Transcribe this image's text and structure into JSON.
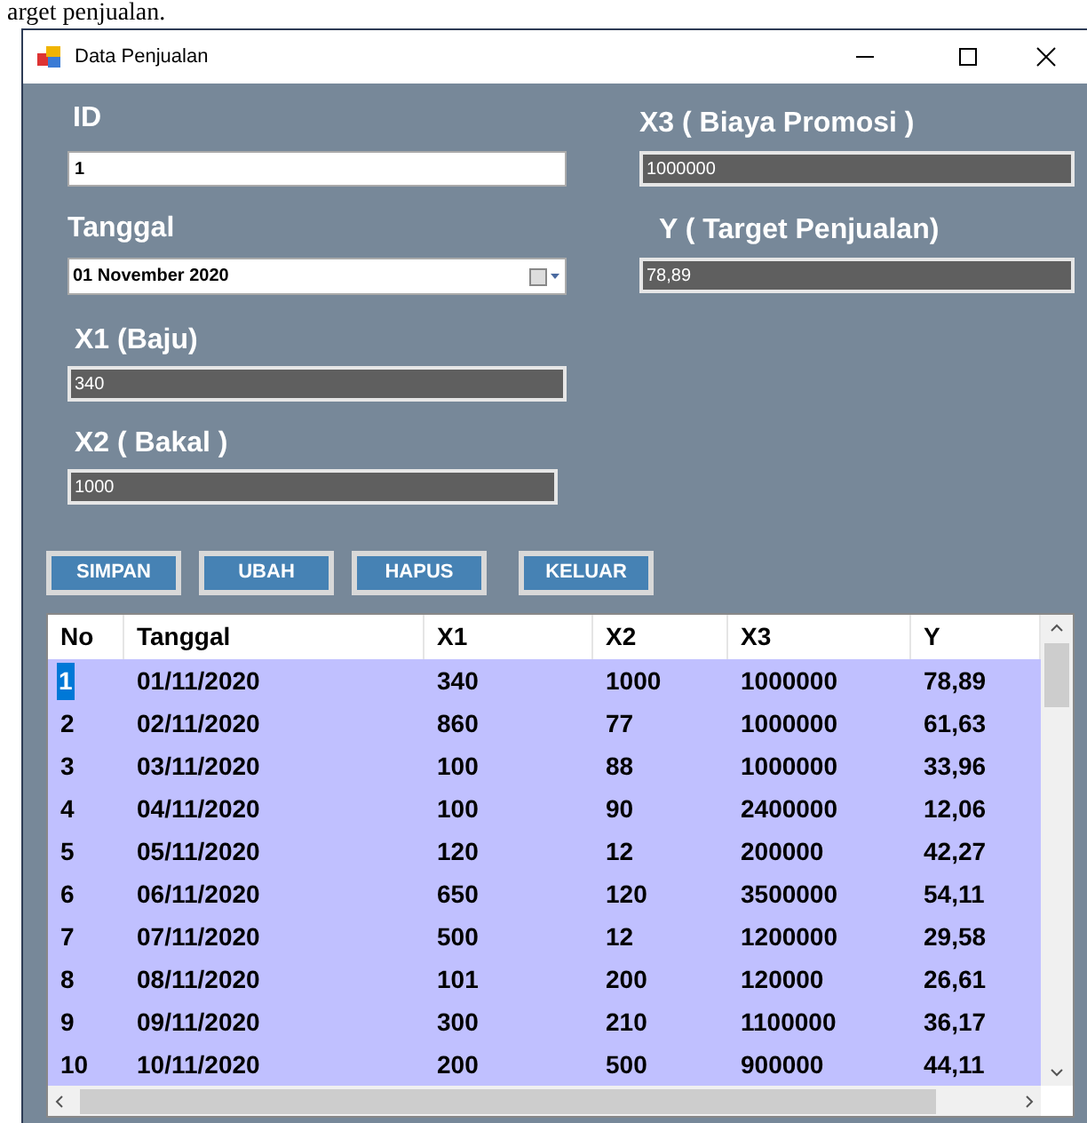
{
  "caption": "arget penjualan.",
  "window": {
    "title": "Data Penjualan"
  },
  "fields": {
    "id": {
      "label": "ID",
      "value": "1"
    },
    "tanggal": {
      "label": "Tanggal",
      "value": "01 November  2020"
    },
    "x1": {
      "label": "X1 (Baju)",
      "value": "340"
    },
    "x2": {
      "label": "X2 ( Bakal )",
      "value": "1000"
    },
    "x3": {
      "label": "X3 ( Biaya Promosi )",
      "value": "1000000"
    },
    "y": {
      "label": "Y ( Target Penjualan)",
      "value": "78,89"
    }
  },
  "buttons": [
    "SIMPAN",
    "UBAH",
    "HAPUS",
    "KELUAR"
  ],
  "table": {
    "columns": [
      "No",
      "Tanggal",
      "X1",
      "X2",
      "X3",
      "Y"
    ],
    "rows": [
      {
        "cells": [
          "1",
          "01/11/2020",
          "340",
          "1000",
          "1000000",
          "78,89"
        ],
        "selected": true
      },
      {
        "cells": [
          "2",
          "02/11/2020",
          "860",
          "77",
          "1000000",
          "61,63"
        ],
        "selected": false
      },
      {
        "cells": [
          "3",
          "03/11/2020",
          "100",
          "88",
          "1000000",
          "33,96"
        ],
        "selected": false
      },
      {
        "cells": [
          "4",
          "04/11/2020",
          "100",
          "90",
          "2400000",
          "12,06"
        ],
        "selected": false
      },
      {
        "cells": [
          "5",
          "05/11/2020",
          "120",
          "12",
          "200000",
          "42,27"
        ],
        "selected": false
      },
      {
        "cells": [
          "6",
          "06/11/2020",
          "650",
          "120",
          "3500000",
          "54,11"
        ],
        "selected": false
      },
      {
        "cells": [
          "7",
          "07/11/2020",
          "500",
          "12",
          "1200000",
          "29,58"
        ],
        "selected": false
      },
      {
        "cells": [
          "8",
          "08/11/2020",
          "101",
          "200",
          "120000",
          "26,61"
        ],
        "selected": false
      },
      {
        "cells": [
          "9",
          "09/11/2020",
          "300",
          "210",
          "1100000",
          "36,17"
        ],
        "selected": false
      },
      {
        "cells": [
          "10",
          "10/11/2020",
          "200",
          "500",
          "900000",
          "44,11"
        ],
        "selected": false
      }
    ]
  }
}
